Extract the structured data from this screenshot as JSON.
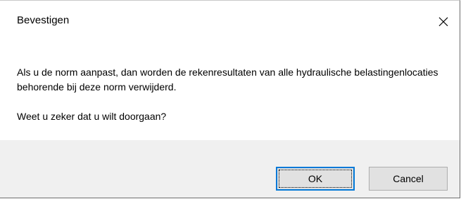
{
  "dialog": {
    "title": "Bevestigen",
    "close_icon": "close-icon",
    "message": "Als u de norm aanpast, dan worden de rekenresultaten van alle hydraulische belastingenlocaties behorende bij deze norm verwijderd.",
    "question": "Weet u zeker dat u wilt doorgaan?",
    "buttons": {
      "ok_label": "OK",
      "cancel_label": "Cancel"
    }
  },
  "colors": {
    "accent": "#0078d7",
    "footer_bg": "#f0f0f0",
    "button_bg": "#e1e1e1"
  }
}
